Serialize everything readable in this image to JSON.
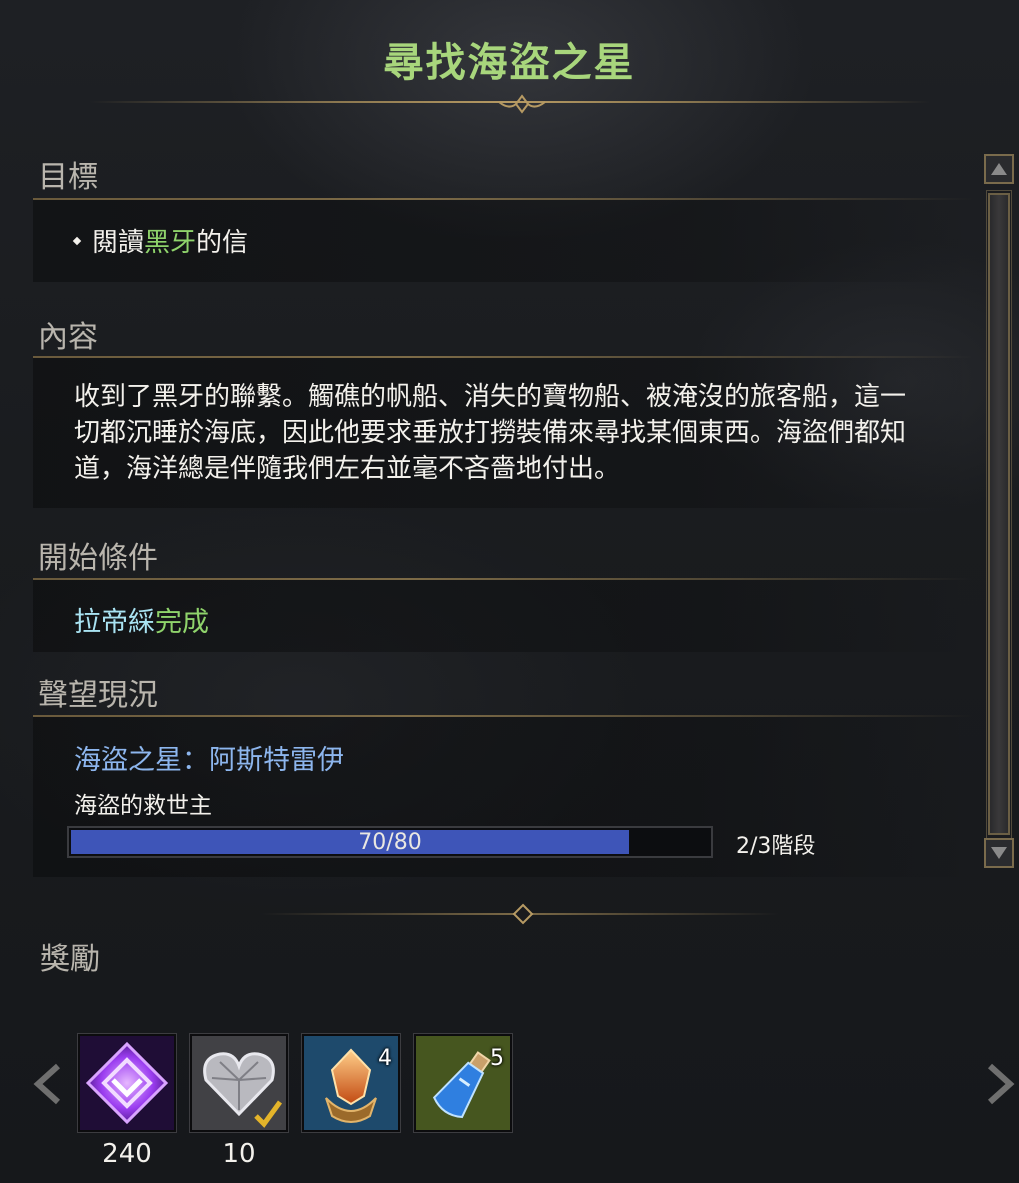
{
  "quest": {
    "title": "尋找海盜之星"
  },
  "objective": {
    "header": "目標",
    "prefix": "閱讀",
    "highlight": "黑牙",
    "suffix": "的信"
  },
  "content": {
    "header": "內容",
    "text": "收到了黑牙的聯繫。觸礁的帆船、消失的寶物船、被淹沒的旅客船，這一切都沉睡於海底，因此他要求垂放打撈裝備來尋找某個東西。海盜們都知道，海洋總是伴隨我們左右並毫不吝嗇地付出。"
  },
  "start_condition": {
    "header": "開始條件",
    "npc": "拉帝綵",
    "status": "完成"
  },
  "reputation": {
    "header": "聲望現況",
    "name": "海盜之星：阿斯特雷伊",
    "rank": "海盜的救世主",
    "progress_text": "70/80",
    "current": 70,
    "max": 80,
    "stage": "2/3階段"
  },
  "rewards": {
    "header": "獎勵",
    "items": [
      {
        "icon": "purple-crystal-icon",
        "quantity": "240",
        "badge": ""
      },
      {
        "icon": "crystal-heart-icon",
        "quantity": "10",
        "badge": "",
        "checked": true
      },
      {
        "icon": "amber-gem-icon",
        "quantity": "",
        "badge": "4"
      },
      {
        "icon": "blue-potion-icon",
        "quantity": "",
        "badge": "5"
      }
    ]
  },
  "colors": {
    "title": "#a8d67c",
    "highlight_green": "#8fd36b",
    "npc_cyan": "#a9e3f2",
    "reputation_blue": "#8db6ee",
    "progress_fill": "#3e55b8",
    "gold_line": "#7d6b47"
  }
}
